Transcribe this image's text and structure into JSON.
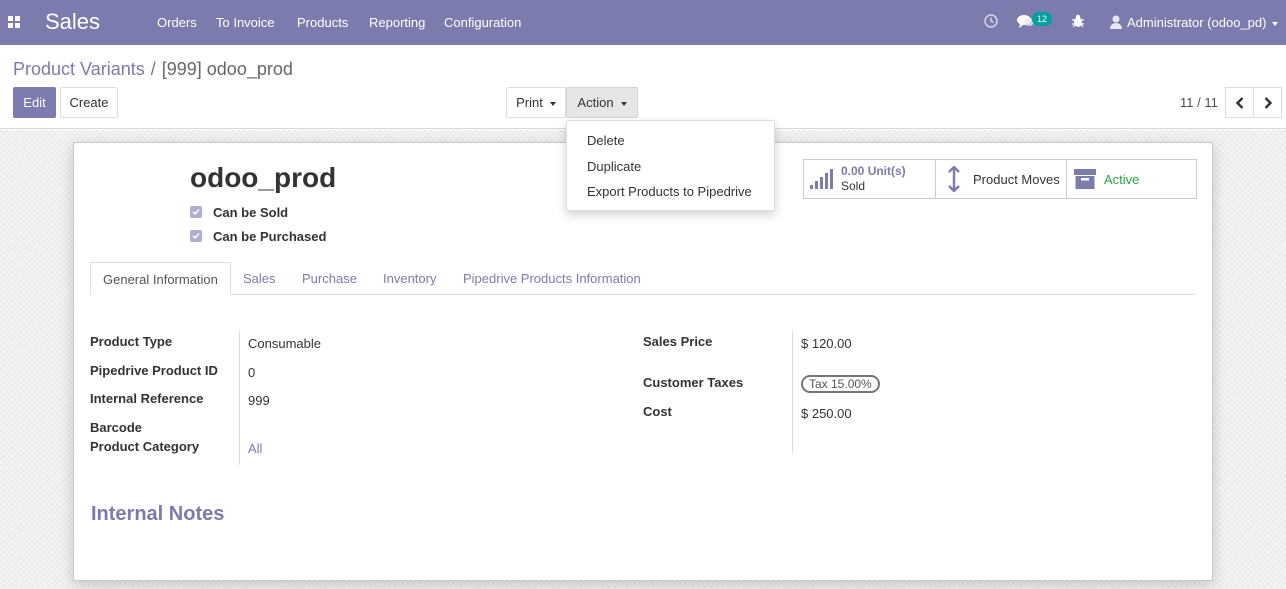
{
  "navbar": {
    "app_title": "Sales",
    "menu": [
      "Orders",
      "To Invoice",
      "Products",
      "Reporting",
      "Configuration"
    ],
    "message_count": "12",
    "user": "Administrator (odoo_pd)",
    "color": "#7c7bad"
  },
  "breadcrumb": {
    "parent": "Product Variants",
    "separator": "/",
    "current": "[999] odoo_prod"
  },
  "toolbar": {
    "edit_label": "Edit",
    "create_label": "Create",
    "print_label": "Print",
    "action_label": "Action"
  },
  "action_menu": {
    "items": [
      "Delete",
      "Duplicate",
      "Export Products to Pipedrive"
    ]
  },
  "pager": {
    "value": "11 / 11"
  },
  "product": {
    "name": "odoo_prod",
    "can_be_sold_label": "Can be Sold",
    "can_be_sold": true,
    "can_be_purchased_label": "Can be Purchased",
    "can_be_purchased": true
  },
  "smart_buttons": {
    "sold_value": "0.00 Unit(s)",
    "sold_label": "Sold",
    "moves_label": "Product Moves",
    "active_label": "Active",
    "active_color": "#28a745"
  },
  "tabs": [
    "General Information",
    "Sales",
    "Purchase",
    "Inventory",
    "Pipedrive Products Information"
  ],
  "active_tab": "General Information",
  "fields_left": {
    "product_type_label": "Product Type",
    "product_type": "Consumable",
    "pipedrive_id_label": "Pipedrive Product ID",
    "pipedrive_id": "0",
    "internal_ref_label": "Internal Reference",
    "internal_ref": "999",
    "barcode_label": "Barcode",
    "category_label": "Product Category",
    "category": "All"
  },
  "fields_right": {
    "sales_price_label": "Sales Price",
    "sales_price": "$ 120.00",
    "customer_taxes_label": "Customer Taxes",
    "customer_tax_tag": "Tax 15.00%",
    "cost_label": "Cost",
    "cost": "$ 250.00"
  },
  "notes": {
    "title": "Internal Notes"
  }
}
